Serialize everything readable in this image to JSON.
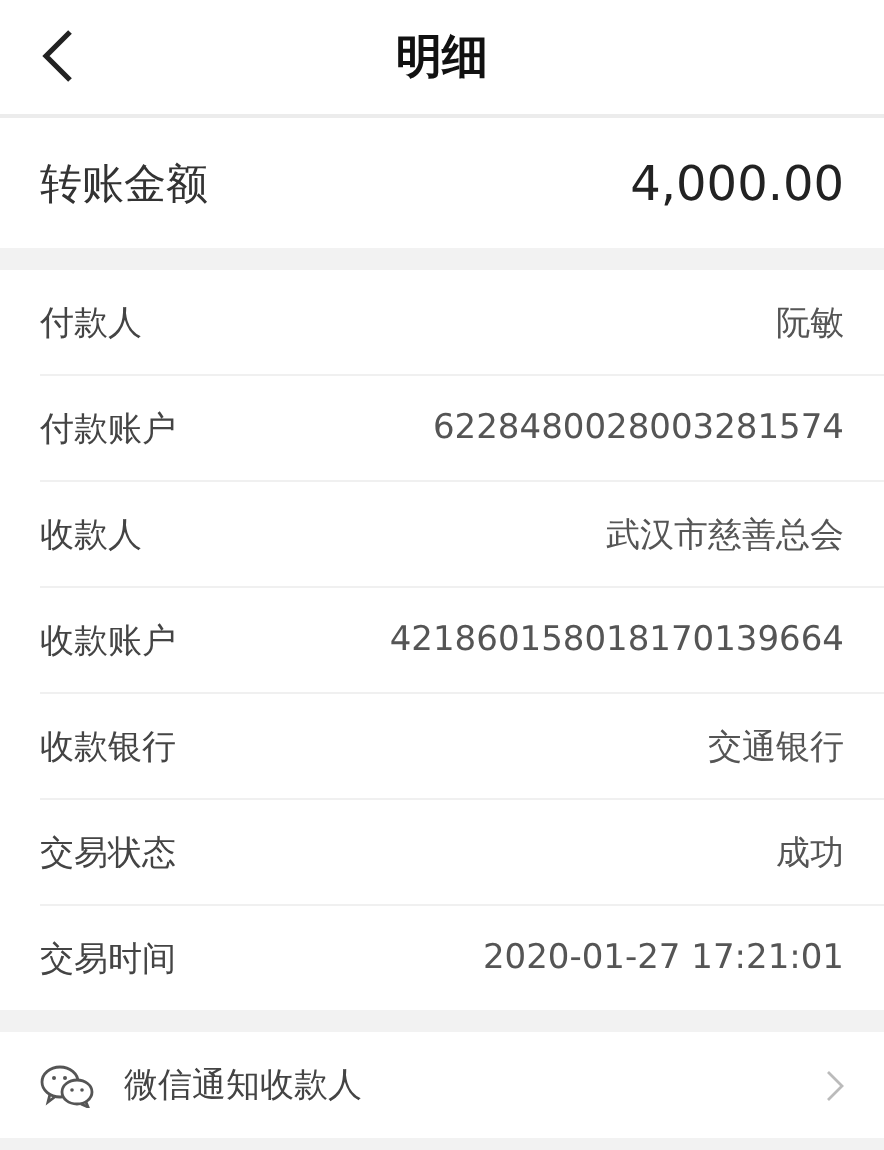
{
  "header": {
    "title": "明细"
  },
  "amount": {
    "label": "转账金额",
    "value": "4,000.00"
  },
  "details": [
    {
      "label": "付款人",
      "value": "阮敏"
    },
    {
      "label": "付款账户",
      "value": "6228480028003281574"
    },
    {
      "label": "收款人",
      "value": "武汉市慈善总会"
    },
    {
      "label": "收款账户",
      "value": "421860158018170139664"
    },
    {
      "label": "收款银行",
      "value": "交通银行"
    },
    {
      "label": "交易状态",
      "value": "成功"
    },
    {
      "label": "交易时间",
      "value": "2020-01-27 17:21:01"
    }
  ],
  "action": {
    "label": "微信通知收款人"
  }
}
